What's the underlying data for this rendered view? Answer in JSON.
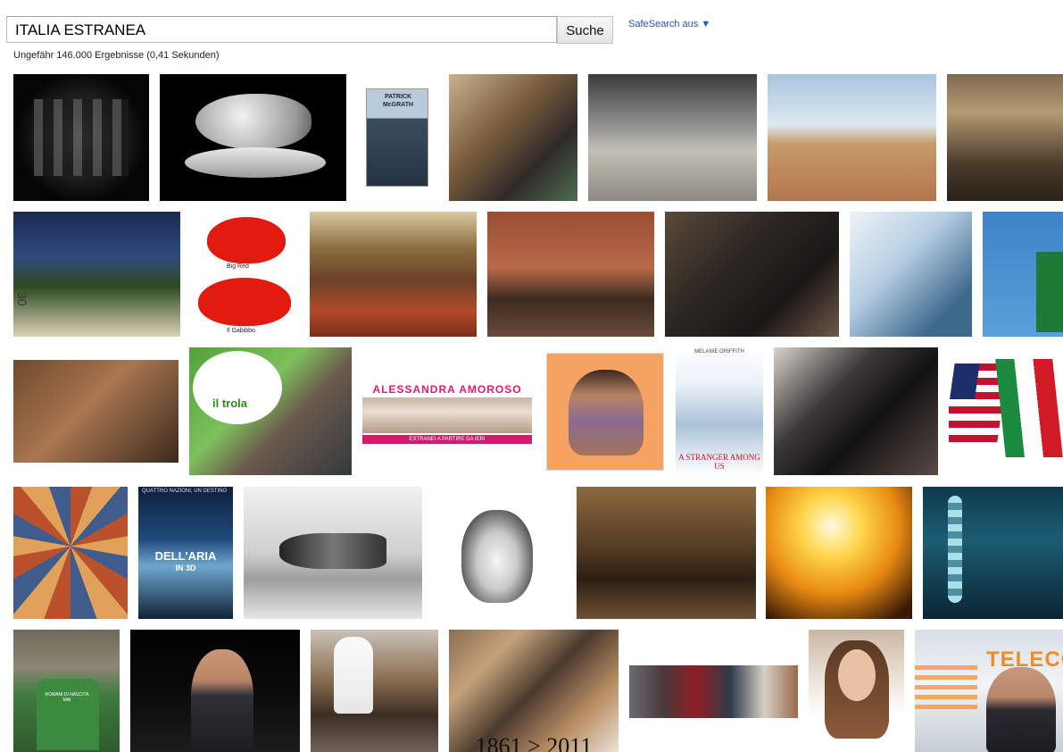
{
  "search": {
    "query": "ITALIA ESTRANEA",
    "button_label": "Suche",
    "safesearch_label": "SafeSearch aus ▼",
    "result_stats": "Ungefähr 146.000 Ergebnisse (0,41 Sekunden)"
  },
  "thumbnails": {
    "r2_1": {
      "caption_top": "Big Red",
      "caption_bottom": "Il Gabibbo"
    },
    "r2_0": {
      "house_number": "30"
    },
    "r1_2": {
      "author": "PATRICK McGRATH"
    },
    "r3_1": {
      "bubble_text": "il trola"
    },
    "r3_2": {
      "title": "ALESSANDRA AMOROSO",
      "subtitle": "ESTRANEI A PARTIRE DA IERI"
    },
    "r3_4": {
      "actor": "MELANIE GRIFFITH",
      "title": "A STRANGER AMONG US"
    },
    "r4_1": {
      "tagline": "QUATTRO NAZIONI, UN DESTINO",
      "title": "DELL'ARIA",
      "format": "IN 3D"
    },
    "r5_0": {
      "shirt_text": "ROMANI DI NASCITA MAI"
    },
    "r5_3": {
      "years": "1861 > 2011"
    },
    "r5_6": {
      "logo": "TELECO"
    }
  }
}
